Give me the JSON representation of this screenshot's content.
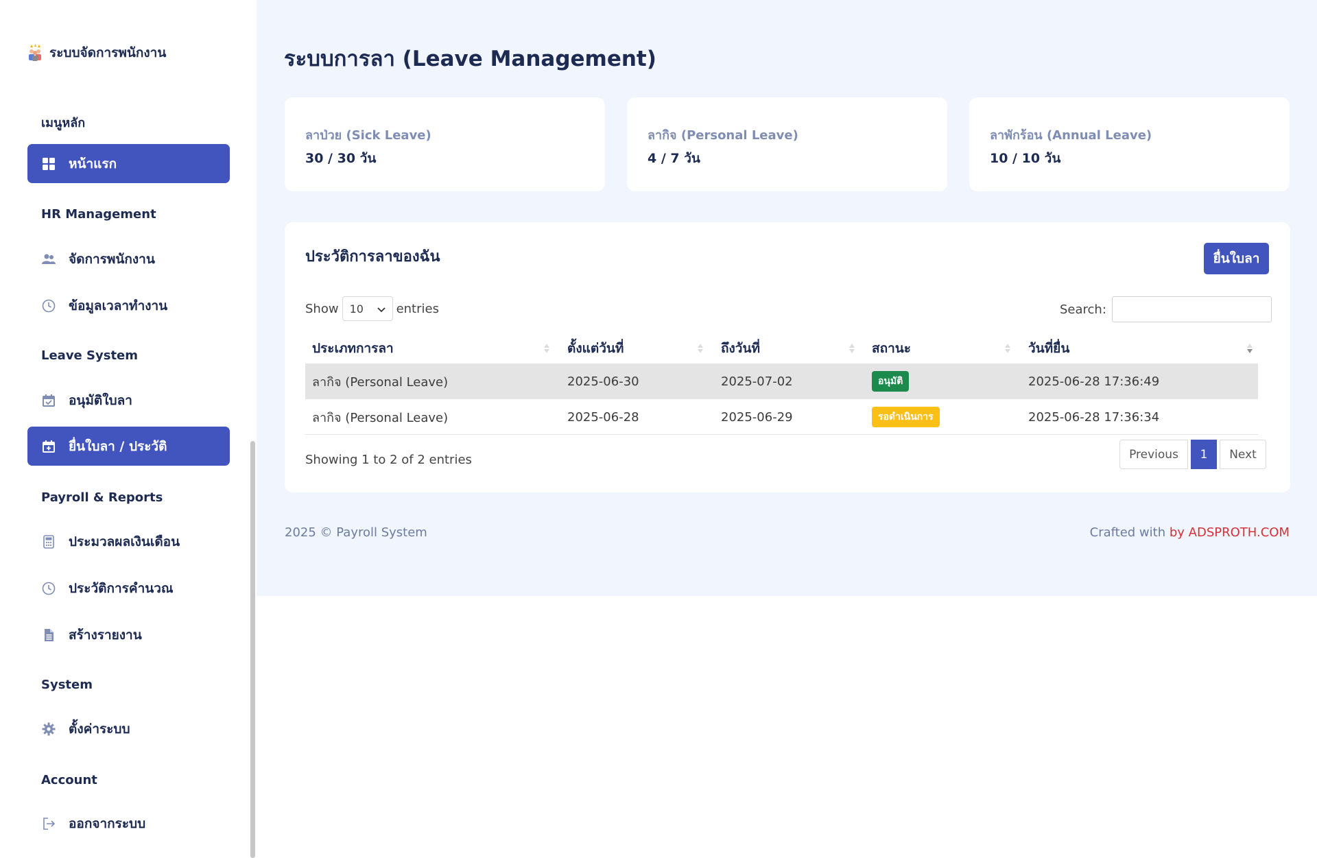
{
  "sidebar": {
    "brand": "ระบบจัดการพนักงาน",
    "sections": {
      "main": "เมนูหลัก",
      "hr": "HR Management",
      "leave": "Leave System",
      "payroll": "Payroll & Reports",
      "system": "System",
      "account": "Account"
    },
    "items": {
      "home": "หน้าแรก",
      "employees": "จัดการพนักงาน",
      "worktime": "ข้อมูลเวลาทำงาน",
      "approve_leave": "อนุมัติใบลา",
      "request_leave": "ยื่นใบลา / ประวัติ",
      "payroll_process": "ประมวลผลเงินเดือน",
      "calc_history": "ประวัติการคำนวณ",
      "reports": "สร้างรายงาน",
      "settings": "ตั้งค่าระบบ",
      "logout": "ออกจากระบบ"
    },
    "icons": {
      "home": "dashboard-grid-icon",
      "employees": "users-icon",
      "worktime": "clock-icon",
      "approve_leave": "calendar-check-icon",
      "request_leave": "calendar-plus-icon",
      "payroll_process": "calculator-icon",
      "calc_history": "history-clock-icon",
      "reports": "file-report-icon",
      "settings": "gear-icon",
      "logout": "logout-icon"
    },
    "active_color": "#4255be"
  },
  "main": {
    "title": "ระบบการลา (Leave Management)",
    "stats": [
      {
        "label": "ลาป่วย (Sick Leave)",
        "value": "30 / 30 วัน"
      },
      {
        "label": "ลากิจ (Personal Leave)",
        "value": "4 / 7 วัน"
      },
      {
        "label": "ลาพักร้อน (Annual Leave)",
        "value": "10 / 10 วัน"
      }
    ],
    "history": {
      "title": "ประวัติการลาของฉัน",
      "apply_label": "ยื่นใบลา",
      "show_label": "Show",
      "entries_value": "10",
      "entries_label": "entries",
      "search_label": "Search:",
      "search_value": "",
      "columns": [
        "ประเภทการลา",
        "ตั้งแต่วันที่",
        "ถึงวันที่",
        "สถานะ",
        "วันที่ยื่น"
      ],
      "rows": [
        {
          "type": "ลากิจ (Personal Leave)",
          "from": "2025-06-30",
          "to": "2025-07-02",
          "status": "อนุมัติ",
          "status_color": "#1b8a4c",
          "submitted": "2025-06-28 17:36:49"
        },
        {
          "type": "ลากิจ (Personal Leave)",
          "from": "2025-06-28",
          "to": "2025-06-29",
          "status": "รอดำเนินการ",
          "status_color": "#fbbf15",
          "submitted": "2025-06-28 17:36:34"
        }
      ],
      "info": "Showing 1 to 2 of 2 entries",
      "pager": {
        "prev": "Previous",
        "current": "1",
        "next": "Next"
      }
    }
  },
  "footer": {
    "left": "2025 © Payroll System",
    "right_prefix": "Crafted with",
    "right_link": "by ADSPROTH.COM"
  }
}
